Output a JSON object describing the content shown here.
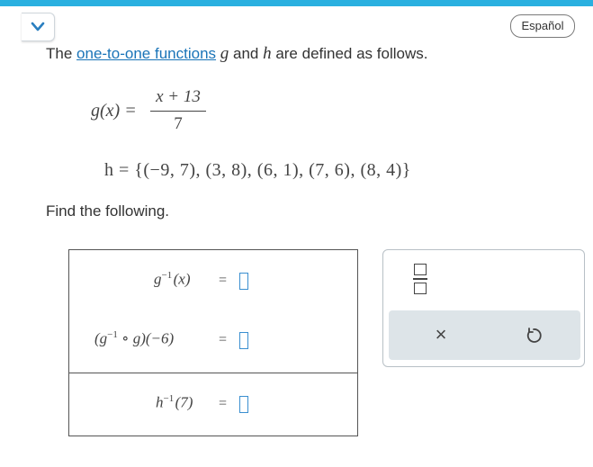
{
  "header": {
    "language_button": "Español"
  },
  "intro": {
    "prefix": "The ",
    "link": "one-to-one functions",
    "mid1": " g",
    "mid2": " and ",
    "mid3": "h",
    "suffix": " are defined as follows."
  },
  "g_def": {
    "lhs": "g(x) =",
    "numerator": "x + 13",
    "denominator": "7"
  },
  "h_def": {
    "text": "h = {(−9, 7), (3, 8), (6, 1), (7, 6), (8, 4)}"
  },
  "prompt": "Find the following.",
  "questions": [
    {
      "expr": "g",
      "sup": "−1",
      "arg": "(x)",
      "equals": "="
    },
    {
      "expr_open": "(g",
      "sup": "−1",
      "expr_mid": " ∘ g)(−6)",
      "equals": "="
    },
    {
      "expr": "h",
      "sup": "−1",
      "arg": "(7)",
      "equals": "="
    }
  ],
  "palette": {
    "icons": [
      "fraction-icon",
      "clear-icon",
      "undo-icon"
    ],
    "clear_glyph": "×"
  },
  "colors": {
    "accent": "#2ab0e0",
    "link": "#1a74b8",
    "answer_box": "#3a8fd0",
    "action_bg": "#dde4e8"
  }
}
